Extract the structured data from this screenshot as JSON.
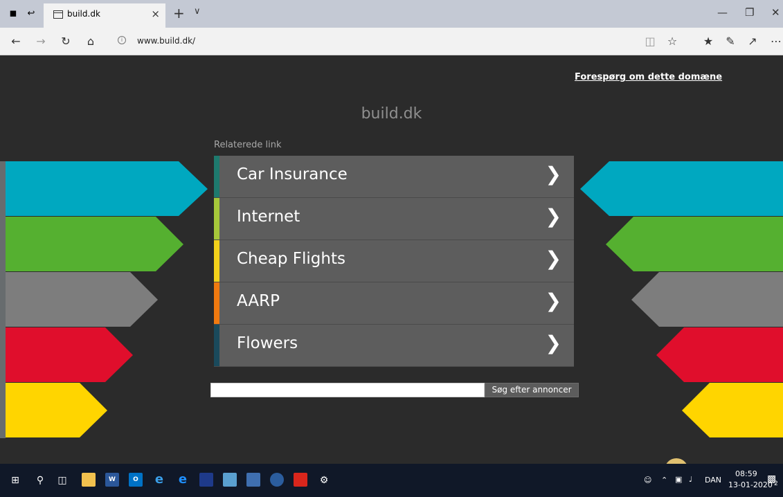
{
  "window": {
    "tab_title": "build.dk",
    "tab_close": "×",
    "new_tab": "+",
    "tab_menu": "∨",
    "minimize": "—",
    "restore": "❐",
    "close": "✕"
  },
  "addressbar": {
    "url": "www.build.dk/"
  },
  "page": {
    "inquire_link": "Forespørg om dette domæne",
    "domain_title": "build.dk",
    "related_label": "Relaterede link",
    "links": [
      {
        "label": "Car Insurance",
        "color": "#1e7a6e"
      },
      {
        "label": "Internet",
        "color": "#a6c83a"
      },
      {
        "label": "Cheap Flights",
        "color": "#f3d21b"
      },
      {
        "label": "AARP",
        "color": "#f07a10"
      },
      {
        "label": "Flowers",
        "color": "#1a4a5c"
      }
    ],
    "search_placeholder": "",
    "search_button": "Søg efter annoncer"
  },
  "decor": {
    "colors": [
      "#00a8c0",
      "#55b030",
      "#7d7d7d",
      "#e00e2c",
      "#ffd500"
    ]
  },
  "taskbar": {
    "language": "DAN",
    "time": "08:59",
    "date": "13-01-2020",
    "notification_count": "2"
  }
}
